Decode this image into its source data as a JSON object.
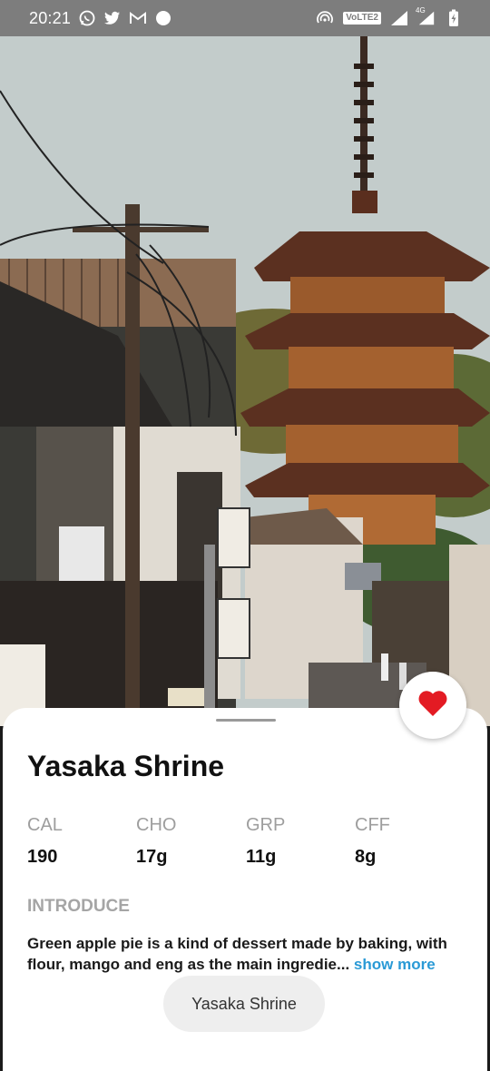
{
  "status_bar": {
    "time": "20:21",
    "left_icons": [
      "whatsapp-icon",
      "twitter-icon",
      "gmail-icon",
      "circle-dot-icon"
    ],
    "right_icons": [
      "hotspot-icon",
      "signal-icon",
      "signal-4g-icon",
      "battery-charging-icon"
    ],
    "network_badge": "VoLTE2",
    "network_type": "4G"
  },
  "place": {
    "title": "Yasaka Shrine",
    "stats": [
      {
        "label": "CAL",
        "value": "190"
      },
      {
        "label": "CHO",
        "value": "17g"
      },
      {
        "label": "GRP",
        "value": "11g"
      },
      {
        "label": "CFF",
        "value": "8g"
      }
    ],
    "intro_label": "INTRODUCE",
    "description": "Green apple pie is a kind of dessert made by baking, with flour, mango and eng as the main ingredie...",
    "show_more": "show more",
    "pill_label": "Yasaka Shrine"
  },
  "colors": {
    "accent": "#2a9ad6",
    "heart": "#e31b23",
    "sky": "#c3cccb",
    "pagoda": "#7a3a22"
  }
}
